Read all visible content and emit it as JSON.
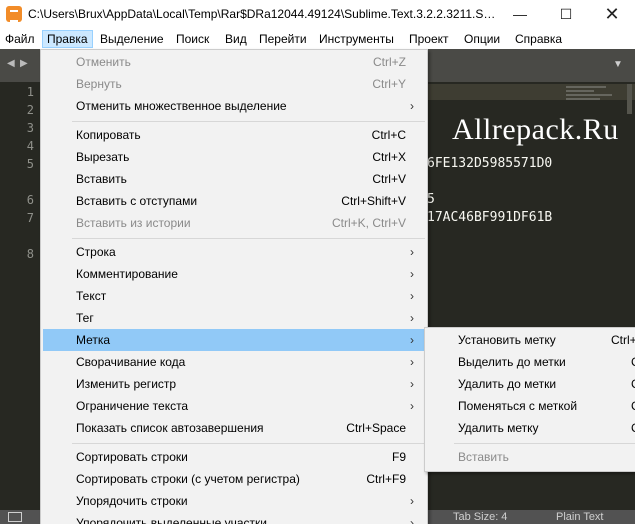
{
  "window": {
    "title": "C:\\Users\\Brux\\AppData\\Local\\Temp\\Rar$DRa12044.49124\\Sublime.Text.3.2.2.3211.Setup...",
    "minimize_glyph": "—",
    "maximize_glyph": "☐",
    "close_glyph": "✕"
  },
  "menubar": {
    "items": [
      "Файл",
      "Правка",
      "Выделение",
      "Поиск",
      "Вид",
      "Перейти",
      "Инструменты",
      "Проект",
      "Опции",
      "Справка"
    ],
    "active": "Правка"
  },
  "tabstrip": {
    "left_arrow": "◀",
    "right_arrow": "▶",
    "dropdown_arrow": "▼"
  },
  "editor": {
    "line_numbers": [
      "1",
      "2",
      "3",
      "4",
      "5",
      "6",
      "7",
      "8"
    ],
    "visible_code": [
      "6FE132D5985571D0",
      "5",
      "17AC46BF991DF61B"
    ],
    "watermark": "Allrepack.Ru"
  },
  "edit_menu": {
    "items": [
      {
        "label": "Отменить",
        "shortcut": "Ctrl+Z",
        "disabled": true
      },
      {
        "label": "Вернуть",
        "shortcut": "Ctrl+Y",
        "disabled": true
      },
      {
        "label": "Отменить множественное выделение",
        "submenu": true
      },
      {
        "label": "Копировать",
        "shortcut": "Ctrl+C"
      },
      {
        "label": "Вырезать",
        "shortcut": "Ctrl+X"
      },
      {
        "label": "Вставить",
        "shortcut": "Ctrl+V"
      },
      {
        "label": "Вставить с отступами",
        "shortcut": "Ctrl+Shift+V"
      },
      {
        "label": "Вставить из истории",
        "shortcut": "Ctrl+K, Ctrl+V",
        "disabled": true
      },
      {
        "label": "Строка",
        "submenu": true
      },
      {
        "label": "Комментирование",
        "submenu": true
      },
      {
        "label": "Текст",
        "submenu": true
      },
      {
        "label": "Тег",
        "submenu": true
      },
      {
        "label": "Метка",
        "submenu": true,
        "highlighted": true
      },
      {
        "label": "Сворачивание кода",
        "submenu": true
      },
      {
        "label": "Изменить регистр",
        "submenu": true
      },
      {
        "label": "Ограничение текста",
        "submenu": true
      },
      {
        "label": "Показать список автозавершения",
        "shortcut": "Ctrl+Space"
      },
      {
        "label": "Сортировать строки",
        "shortcut": "F9"
      },
      {
        "label": "Сортировать строки (с учетом регистра)",
        "shortcut": "Ctrl+F9"
      },
      {
        "label": "Упорядочить строки",
        "submenu": true
      },
      {
        "label": "Упорядочить выделенные участки",
        "submenu": true
      }
    ],
    "submenu_arrow": "›"
  },
  "mark_submenu": {
    "items": [
      {
        "label": "Установить метку",
        "shortcut": "Ctrl+"
      },
      {
        "label": "Выделить до метки",
        "shortcut": "C"
      },
      {
        "label": "Удалить до метки",
        "shortcut": "C"
      },
      {
        "label": "Поменяться с меткой",
        "shortcut": "C"
      },
      {
        "label": "Удалить метку",
        "shortcut": "C"
      },
      {
        "label": "Вставить",
        "disabled": true
      }
    ]
  },
  "statusbar": {
    "tab_size": "Tab Size: 4",
    "syntax": "Plain Text"
  },
  "colors": {
    "editor_bg": "#272822",
    "menu_bg": "#f2f2f2",
    "menu_highlight": "#91c9f7",
    "active_menu": "#cce8ff"
  }
}
